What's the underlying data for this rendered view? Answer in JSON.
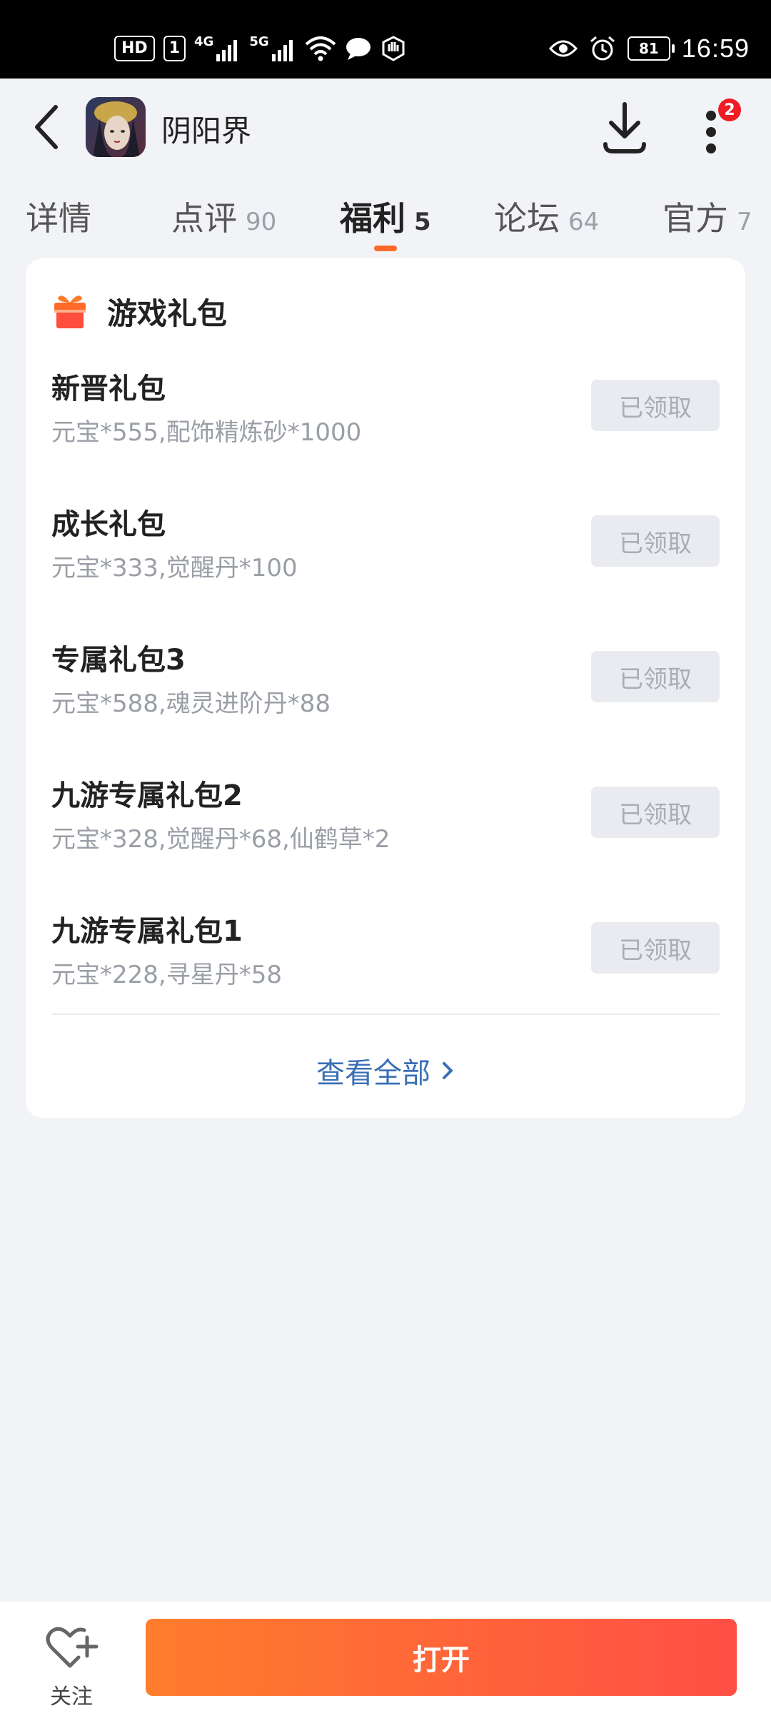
{
  "status_bar": {
    "hd_label": "HD",
    "sim_label": "1",
    "net1_label": "4G",
    "net2_label": "5G",
    "battery_level": "81",
    "time": "16:59"
  },
  "header": {
    "title": "阴阳界",
    "more_badge_count": "2"
  },
  "tabs": [
    {
      "label": "详情",
      "count": ""
    },
    {
      "label": "点评",
      "count": "90"
    },
    {
      "label": "福利",
      "count": "5",
      "active": true
    },
    {
      "label": "论坛",
      "count": "64"
    },
    {
      "label": "官方",
      "count": "7"
    }
  ],
  "gift_section": {
    "title": "游戏礼包",
    "items": [
      {
        "name": "新晋礼包",
        "desc": "元宝*555,配饰精炼砂*1000",
        "button": "已领取"
      },
      {
        "name": "成长礼包",
        "desc": "元宝*333,觉醒丹*100",
        "button": "已领取"
      },
      {
        "name": "专属礼包3",
        "desc": "元宝*588,魂灵进阶丹*88",
        "button": "已领取"
      },
      {
        "name": "九游专属礼包2",
        "desc": "元宝*328,觉醒丹*68,仙鹤草*2",
        "button": "已领取"
      },
      {
        "name": "九游专属礼包1",
        "desc": "元宝*228,寻星丹*58",
        "button": "已领取"
      }
    ],
    "view_all": "查看全部"
  },
  "bottom_bar": {
    "follow_label": "关注",
    "open_label": "打开"
  },
  "colors": {
    "accent": "#ff6a2a",
    "link": "#3a6fb5",
    "badge": "#ee1c25"
  },
  "icons": [
    "back-icon",
    "download-icon",
    "more-vert-icon",
    "gift-icon",
    "chevron-right-icon",
    "heart-plus-icon",
    "wifi-icon",
    "eye-icon",
    "alarm-icon"
  ]
}
